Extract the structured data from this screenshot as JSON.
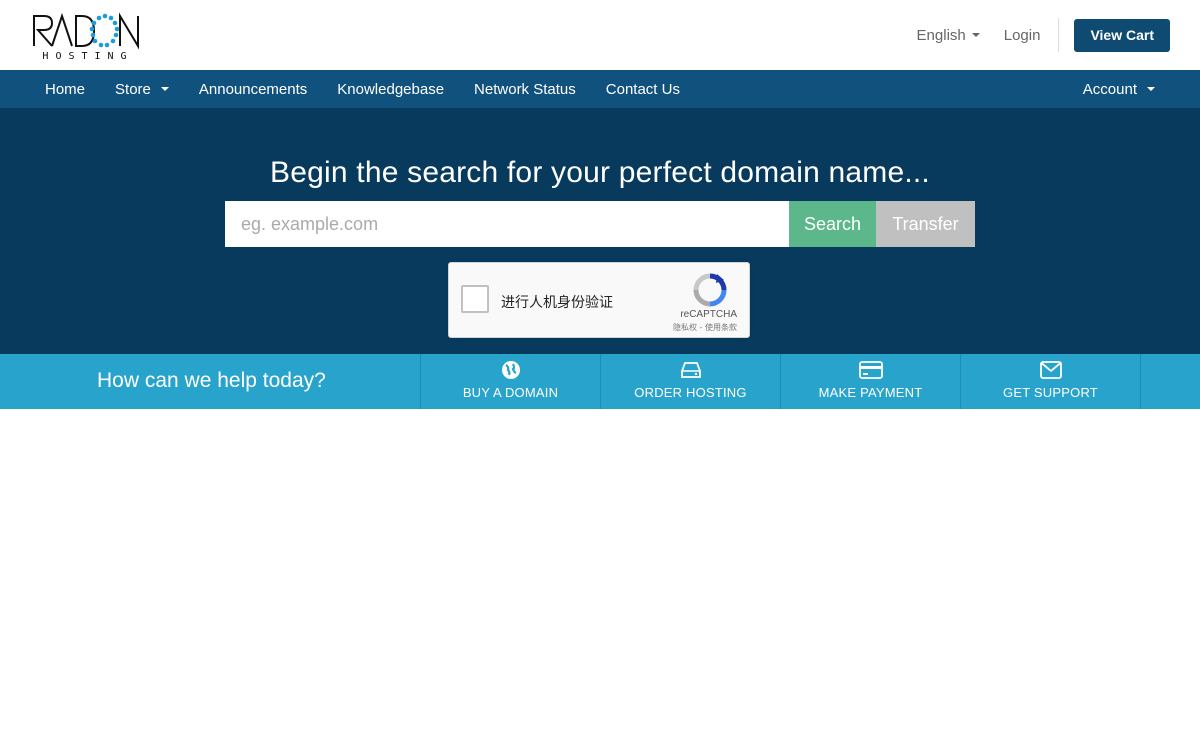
{
  "brand": {
    "logo_text_top": "RADON",
    "logo_text_bottom": "HOSTING",
    "accent_color": "#1e9be0"
  },
  "header": {
    "language": "English",
    "login": "Login",
    "view_cart": "View Cart"
  },
  "nav": {
    "items": [
      {
        "label": "Home",
        "has_dropdown": false
      },
      {
        "label": "Store",
        "has_dropdown": true
      },
      {
        "label": "Announcements",
        "has_dropdown": false
      },
      {
        "label": "Knowledgebase",
        "has_dropdown": false
      },
      {
        "label": "Network Status",
        "has_dropdown": false
      },
      {
        "label": "Contact Us",
        "has_dropdown": false
      }
    ],
    "account": "Account"
  },
  "hero": {
    "title": "Begin the search for your perfect domain name...",
    "search_placeholder": "eg. example.com",
    "search_button": "Search",
    "transfer_button": "Transfer"
  },
  "recaptcha": {
    "label": "进行人机身份验证",
    "brand": "reCAPTCHA",
    "terms": "隐私权 - 使用条款"
  },
  "help": {
    "title": "How can we help today?",
    "items": [
      {
        "label": "BUY A DOMAIN",
        "icon": "globe-icon"
      },
      {
        "label": "ORDER HOSTING",
        "icon": "server-icon"
      },
      {
        "label": "MAKE PAYMENT",
        "icon": "credit-card-icon"
      },
      {
        "label": "GET SUPPORT",
        "icon": "envelope-icon"
      }
    ]
  },
  "colors": {
    "nav_bg": "#10527d",
    "hero_bg": "#073a5d",
    "help_bg": "#28a3cc",
    "search_btn": "#5cb88a",
    "transfer_btn": "#c0c0c0",
    "cart_btn": "#0f4a73"
  }
}
